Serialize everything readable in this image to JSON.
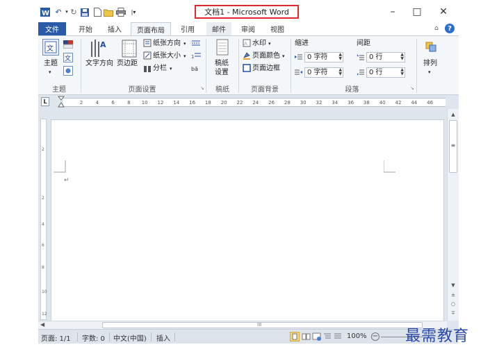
{
  "title_bar": {
    "window_title": "文档1 - Microsoft Word",
    "quick_access_icons": [
      "word-icon",
      "undo-icon",
      "repeat-icon",
      "save-icon",
      "new-document-icon",
      "open-folder-icon",
      "print-icon",
      "customize-qat-icon"
    ],
    "window_controls": {
      "minimize": "–",
      "maximize": "□",
      "close": "✕"
    }
  },
  "tabs": [
    {
      "label": "文件",
      "state": "file"
    },
    {
      "label": "开始",
      "state": "normal"
    },
    {
      "label": "插入",
      "state": "normal"
    },
    {
      "label": "页面布局",
      "state": "active"
    },
    {
      "label": "引用",
      "state": "normal"
    },
    {
      "label": "邮件",
      "state": "normal"
    },
    {
      "label": "审阅",
      "state": "normal"
    },
    {
      "label": "视图",
      "state": "normal"
    }
  ],
  "tab_right_icons": [
    "collapse-ribbon-icon",
    "help-icon"
  ],
  "ribbon": {
    "themes": {
      "theme_button": "主题",
      "group_label": "主题"
    },
    "page_setup": {
      "text_direction": "文字方向",
      "margins": "页边距",
      "orientation": "纸张方向",
      "size": "纸张大小",
      "columns": "分栏",
      "group_label": "页面设置"
    },
    "manuscript": {
      "button_line1": "稿纸",
      "button_line2": "设置",
      "group_label": "稿纸"
    },
    "page_background": {
      "watermark": "水印",
      "page_color": "页面颜色",
      "page_borders": "页面边框",
      "group_label": "页面背景"
    },
    "paragraph": {
      "indent_label": "缩进",
      "spacing_label": "间距",
      "indent_left": "0 字符",
      "indent_right": "0 字符",
      "spacing_before": "0 行",
      "spacing_after": "0 行",
      "group_label": "段落"
    },
    "arrange": {
      "button": "排列"
    }
  },
  "ruler": {
    "ticks": [
      "2",
      "4",
      "6",
      "8",
      "10",
      "12",
      "14",
      "16",
      "18",
      "20",
      "22",
      "24",
      "26",
      "28",
      "30",
      "32",
      "34",
      "36",
      "38",
      "40",
      "42",
      "44",
      "46"
    ]
  },
  "vertical_ruler": {
    "ticks": [
      "2",
      "2",
      "4",
      "6",
      "8",
      "10",
      "12"
    ]
  },
  "document": {
    "paragraph_mark": "↵"
  },
  "horizontal_scroll": {
    "grip": "III"
  },
  "status_bar": {
    "page": "页面: 1/1",
    "word_count": "字数: 0",
    "language": "中文(中国)",
    "insert_mode": "插入",
    "zoom": "100%"
  },
  "watermark_text": "最需教育",
  "colors": {
    "file_tab": "#2a5ba6",
    "title_highlight": "#e3262c",
    "ribbon_bg": "#f4f7fa",
    "doc_bg": "#dfe6ee",
    "watermark": "#2c4aa8"
  }
}
